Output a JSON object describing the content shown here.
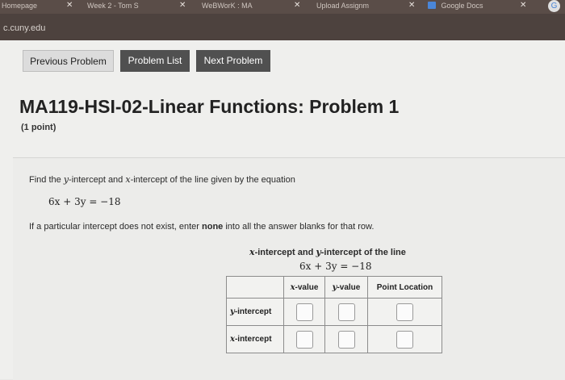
{
  "browser": {
    "tabs": [
      {
        "label": "Homepage"
      },
      {
        "label": "Week 2 - Tom S"
      },
      {
        "label": "WeBWorK : MA"
      },
      {
        "label": "Upload Assignm"
      },
      {
        "label": "Google Docs"
      }
    ],
    "url": "c.cuny.edu"
  },
  "nav": {
    "previous": "Previous Problem",
    "list": "Problem List",
    "next": "Next Problem"
  },
  "page": {
    "title": "MA119-HSI-02-Linear Functions: Problem 1",
    "points": "(1 point)"
  },
  "problem": {
    "prompt_pre": "Find the ",
    "prompt_y": "y",
    "prompt_mid": "-intercept and ",
    "prompt_x": "x",
    "prompt_post": "-intercept of the line given by the equation",
    "equation": "6x + 3y = −18",
    "note_pre": "If a particular intercept does not exist, enter ",
    "note_bold": "none",
    "note_post": " into all the answer blanks for that row."
  },
  "table": {
    "caption_x": "x",
    "caption_mid": "-intercept and ",
    "caption_y": "y",
    "caption_post": "-intercept of the line",
    "caption_equation": "6x + 3y = −18",
    "headers": {
      "x_var": "x",
      "x_suffix": "-value",
      "y_var": "y",
      "y_suffix": "-value",
      "point": "Point Location"
    },
    "rows": [
      {
        "var": "y",
        "suffix": "-intercept",
        "x_value": "",
        "y_value": "",
        "point": ""
      },
      {
        "var": "x",
        "suffix": "-intercept",
        "x_value": "",
        "y_value": "",
        "point": ""
      }
    ]
  }
}
